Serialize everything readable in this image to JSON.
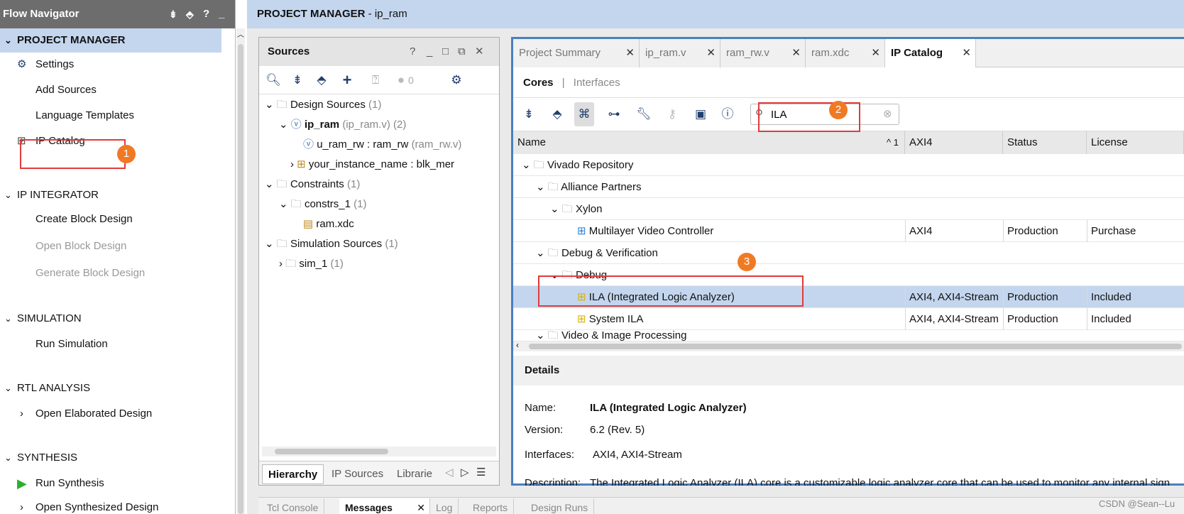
{
  "flow_nav": {
    "title": "Flow Navigator",
    "header_icons": [
      "collapse-all-icon",
      "expand-icon",
      "help-icon",
      "minimize-icon"
    ],
    "sections": [
      {
        "label": "PROJECT MANAGER",
        "items": [
          "Settings",
          "Add Sources",
          "Language Templates",
          "IP Catalog"
        ]
      },
      {
        "label": "IP INTEGRATOR",
        "items": [
          "Create Block Design",
          "Open Block Design",
          "Generate Block Design"
        ]
      },
      {
        "label": "SIMULATION",
        "items": [
          "Run Simulation"
        ]
      },
      {
        "label": "RTL ANALYSIS",
        "items": [
          "Open Elaborated Design"
        ]
      },
      {
        "label": "SYNTHESIS",
        "items": [
          "Run Synthesis",
          "Open Synthesized Design"
        ]
      }
    ]
  },
  "header": {
    "title": "PROJECT MANAGER",
    "separator": " - ",
    "project": "ip_ram"
  },
  "sources": {
    "title": "Sources",
    "title_buttons": [
      "?",
      "_",
      "□",
      "⧉",
      "✕"
    ],
    "status_count": "0",
    "tree": [
      {
        "label": "Design Sources",
        "count": "(1)"
      },
      {
        "label": "ip_ram",
        "detail": "(ip_ram.v) (2)"
      },
      {
        "label": "u_ram_rw : ram_rw",
        "detail": "(ram_rw.v)"
      },
      {
        "label": "your_instance_name : blk_mer",
        "detail": ""
      },
      {
        "label": "Constraints",
        "count": "(1)"
      },
      {
        "label": "constrs_1",
        "count": "(1)"
      },
      {
        "label": "ram.xdc",
        "detail": ""
      },
      {
        "label": "Simulation Sources",
        "count": "(1)"
      },
      {
        "label": "sim_1",
        "count": "(1)"
      }
    ],
    "bottom_tabs": [
      "Hierarchy",
      "IP Sources",
      "Librarie"
    ]
  },
  "ipcat": {
    "tabs": [
      "Project Summary",
      "ip_ram.v",
      "ram_rw.v",
      "ram.xdc",
      "IP Catalog"
    ],
    "subtabs": {
      "cores": "Cores",
      "sep": "|",
      "interfaces": "Interfaces"
    },
    "search_value": "ILA",
    "columns": {
      "name": "Name",
      "sort": "^ 1",
      "axi4": "AXI4",
      "status": "Status",
      "license": "License"
    },
    "rows": [
      {
        "name": "Vivado Repository",
        "axi": "",
        "status": "",
        "license": ""
      },
      {
        "name": "Alliance Partners",
        "axi": "",
        "status": "",
        "license": ""
      },
      {
        "name": "Xylon",
        "axi": "",
        "status": "",
        "license": ""
      },
      {
        "name": "Multilayer Video Controller",
        "axi": "AXI4",
        "status": "Production",
        "license": "Purchase"
      },
      {
        "name": "Debug & Verification",
        "axi": "",
        "status": "",
        "license": ""
      },
      {
        "name": "Debug",
        "axi": "",
        "status": "",
        "license": ""
      },
      {
        "name": "ILA (Integrated Logic Analyzer)",
        "axi": "AXI4, AXI4-Stream",
        "status": "Production",
        "license": "Included"
      },
      {
        "name": "System ILA",
        "axi": "AXI4, AXI4-Stream",
        "status": "Production",
        "license": "Included"
      },
      {
        "name": "Video & Image Processing",
        "axi": "",
        "status": "",
        "license": ""
      }
    ],
    "details": {
      "heading": "Details",
      "name_label": "Name:",
      "name_value": "ILA (Integrated Logic Analyzer)",
      "version_label": "Version:",
      "version_value": "6.2 (Rev. 5)",
      "interfaces_label": "Interfaces:",
      "interfaces_value": "AXI4, AXI4-Stream",
      "description_label": "Description:",
      "description_value": "The Integrated Logic Analyzer (ILA) core is a customizable logic analyzer core that can be used to monitor any internal sign"
    }
  },
  "badges": [
    "1",
    "2",
    "3"
  ],
  "bottom_tabs": [
    "Tcl Console",
    "Messages",
    "Log",
    "Reports",
    "Design Runs"
  ],
  "watermark": "CSDN @Sean--Lu",
  "colors": {
    "selection": "#c4d6ee",
    "accent": "#4a7fc1",
    "annotation": "#e13b3b",
    "badge": "#f07a24"
  }
}
